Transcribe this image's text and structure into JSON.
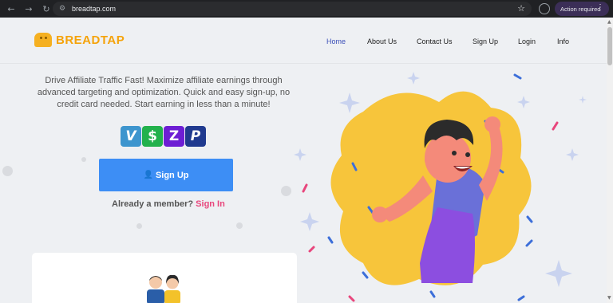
{
  "browser": {
    "url": "breadtap.com",
    "action_label": "Action required"
  },
  "brand": {
    "name": "BREADTAP"
  },
  "nav": [
    {
      "label": "Home",
      "active": true
    },
    {
      "label": "About Us",
      "active": false
    },
    {
      "label": "Contact Us",
      "active": false
    },
    {
      "label": "Sign Up",
      "active": false
    },
    {
      "label": "Login",
      "active": false
    },
    {
      "label": "Info",
      "active": false
    }
  ],
  "hero": {
    "line1": "Drive Affiliate Traffic Fast! Maximize affiliate earnings through",
    "line2": "advanced targeting and optimization. Quick and easy sign-up, no",
    "line3": "credit card needed. Start earning in less than a minute!",
    "payment_icons": [
      "venmo-icon",
      "cash-app-icon",
      "zelle-icon",
      "paypal-icon"
    ],
    "payment_letters": [
      "V",
      "$",
      "Z",
      "P"
    ],
    "signup_label": "Sign Up",
    "member_text": "Already a member?",
    "signin_label": "Sign In"
  },
  "colors": {
    "accent": "#3d8ef5",
    "brand": "#f5a30a",
    "link": "#e8467c",
    "nav_active": "#3b4fb8"
  }
}
